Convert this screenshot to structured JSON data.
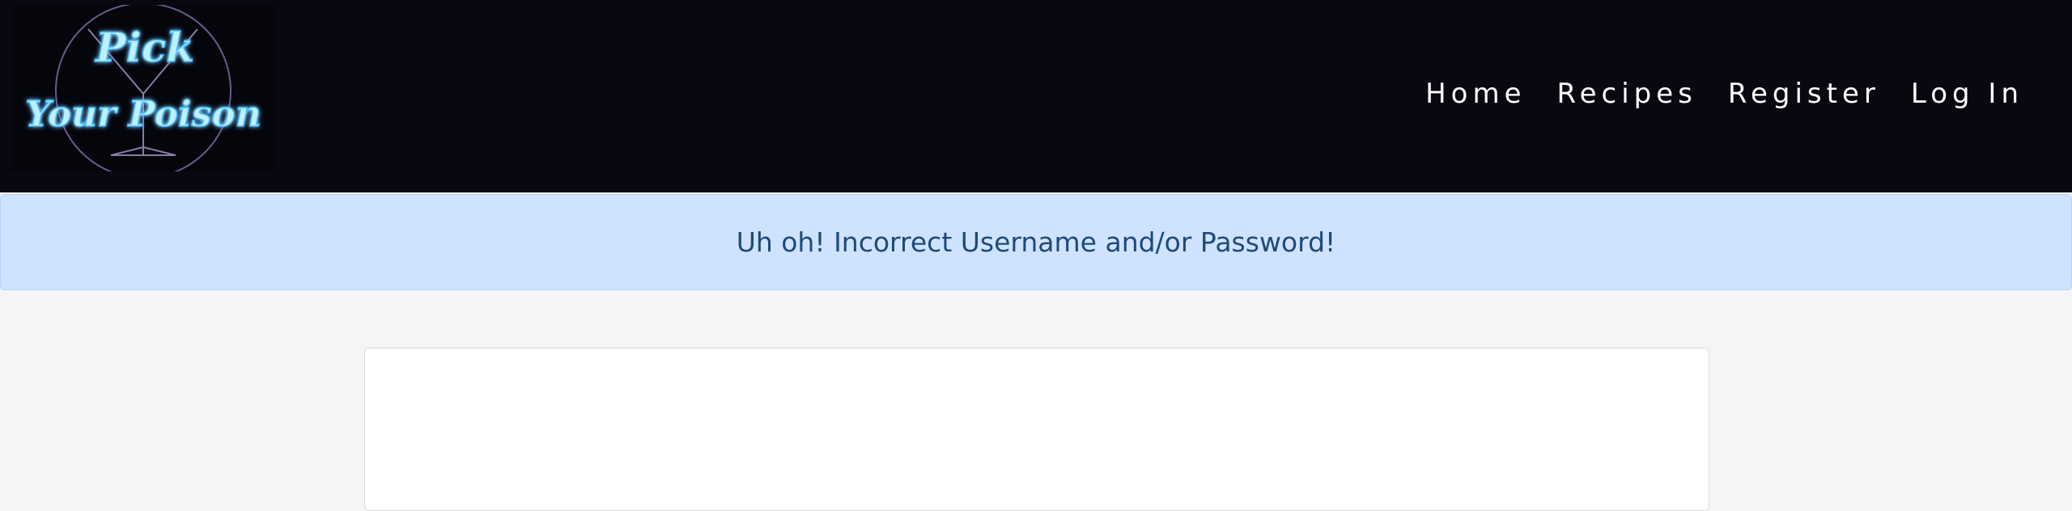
{
  "brand": {
    "logo_line1": "Pick",
    "logo_line2": "Your Poison",
    "neon_color": "#7fdcff"
  },
  "nav": {
    "items": [
      {
        "label": "Home"
      },
      {
        "label": "Recipes"
      },
      {
        "label": "Register"
      },
      {
        "label": "Log In"
      }
    ]
  },
  "alert": {
    "message": "Uh oh! Incorrect Username and/or Password!"
  },
  "card": {
    "heading": ""
  },
  "colors": {
    "navbar_bg": "#080810",
    "alert_bg": "#cfe2ff",
    "alert_text": "#1f4a7a",
    "heading": "#5a0d5c"
  }
}
